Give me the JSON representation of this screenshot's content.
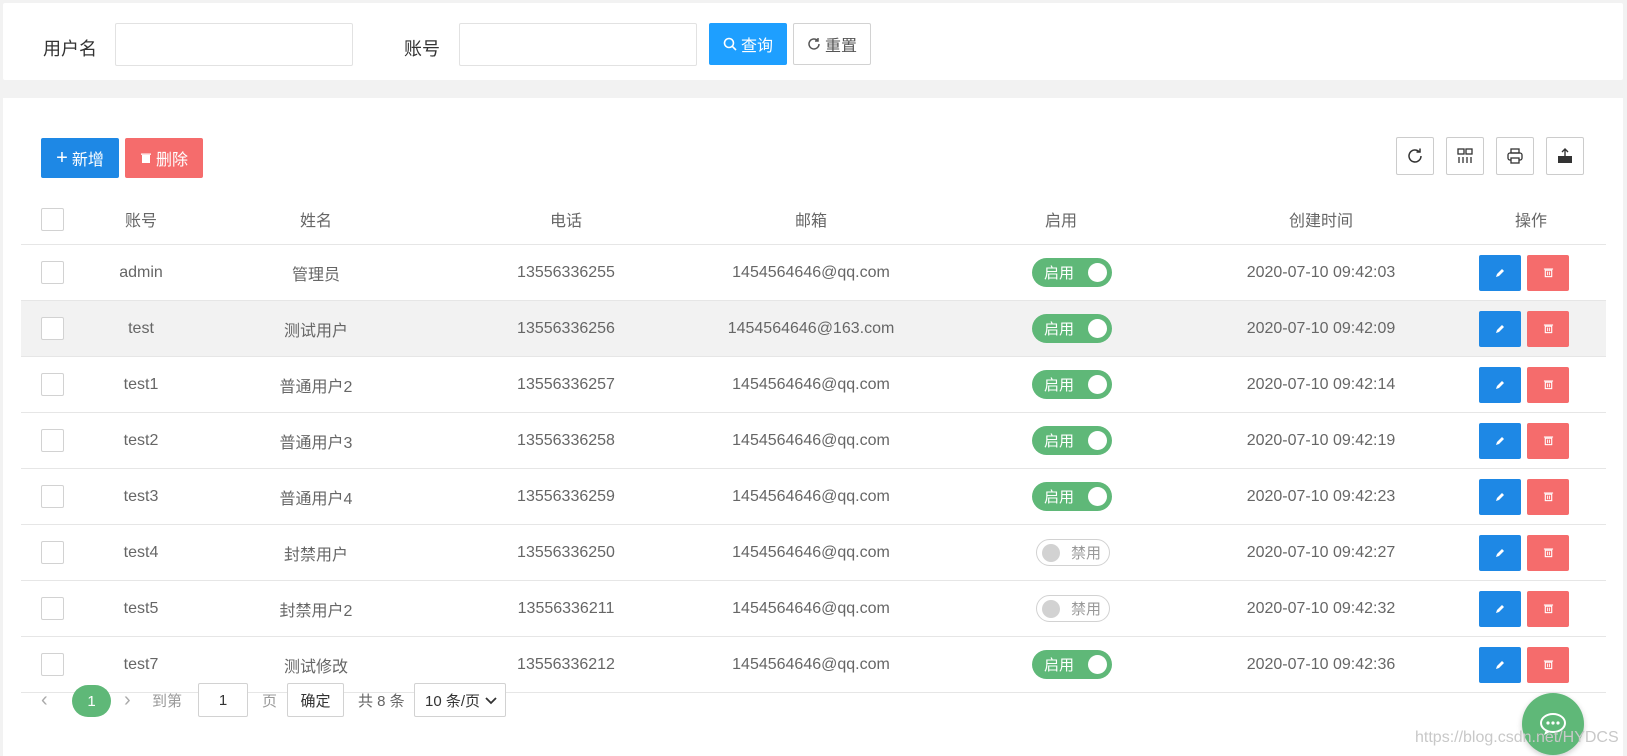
{
  "search": {
    "username_label": "用户名",
    "account_label": "账号",
    "username_value": "",
    "account_value": "",
    "query_label": "查询",
    "reset_label": "重置"
  },
  "toolbar": {
    "add_label": "新增",
    "delete_label": "删除",
    "icons": [
      "refresh-icon",
      "columns-icon",
      "print-icon",
      "export-icon"
    ]
  },
  "table": {
    "columns": [
      "账号",
      "姓名",
      "电话",
      "邮箱",
      "启用",
      "创建时间",
      "操作"
    ],
    "rows": [
      {
        "account": "admin",
        "name": "管理员",
        "phone": "13556336255",
        "email": "1454564646@qq.com",
        "enabled": true,
        "status_label": "启用",
        "created": "2020-07-10 09:42:03"
      },
      {
        "account": "test",
        "name": "测试用户",
        "phone": "13556336256",
        "email": "1454564646@163.com",
        "enabled": true,
        "status_label": "启用",
        "created": "2020-07-10 09:42:09"
      },
      {
        "account": "test1",
        "name": "普通用户2",
        "phone": "13556336257",
        "email": "1454564646@qq.com",
        "enabled": true,
        "status_label": "启用",
        "created": "2020-07-10 09:42:14"
      },
      {
        "account": "test2",
        "name": "普通用户3",
        "phone": "13556336258",
        "email": "1454564646@qq.com",
        "enabled": true,
        "status_label": "启用",
        "created": "2020-07-10 09:42:19"
      },
      {
        "account": "test3",
        "name": "普通用户4",
        "phone": "13556336259",
        "email": "1454564646@qq.com",
        "enabled": true,
        "status_label": "启用",
        "created": "2020-07-10 09:42:23"
      },
      {
        "account": "test4",
        "name": "封禁用户",
        "phone": "13556336250",
        "email": "1454564646@qq.com",
        "enabled": false,
        "status_label": "禁用",
        "created": "2020-07-10 09:42:27"
      },
      {
        "account": "test5",
        "name": "封禁用户2",
        "phone": "13556336211",
        "email": "1454564646@qq.com",
        "enabled": false,
        "status_label": "禁用",
        "created": "2020-07-10 09:42:32"
      },
      {
        "account": "test7",
        "name": "测试修改",
        "phone": "13556336212",
        "email": "1454564646@qq.com",
        "enabled": true,
        "status_label": "启用",
        "created": "2020-07-10 09:42:36"
      }
    ]
  },
  "pagination": {
    "current_page": "1",
    "goto_label": "到第",
    "goto_value": "1",
    "page_label": "页",
    "confirm_label": "确定",
    "total_label": "共 8 条",
    "page_size_label": "10 条/页"
  },
  "watermark": "https://blog.csdn.net/HYDCS",
  "colors": {
    "primary": "#1e9fff",
    "success": "#5fb878",
    "danger": "#f56c6c"
  }
}
